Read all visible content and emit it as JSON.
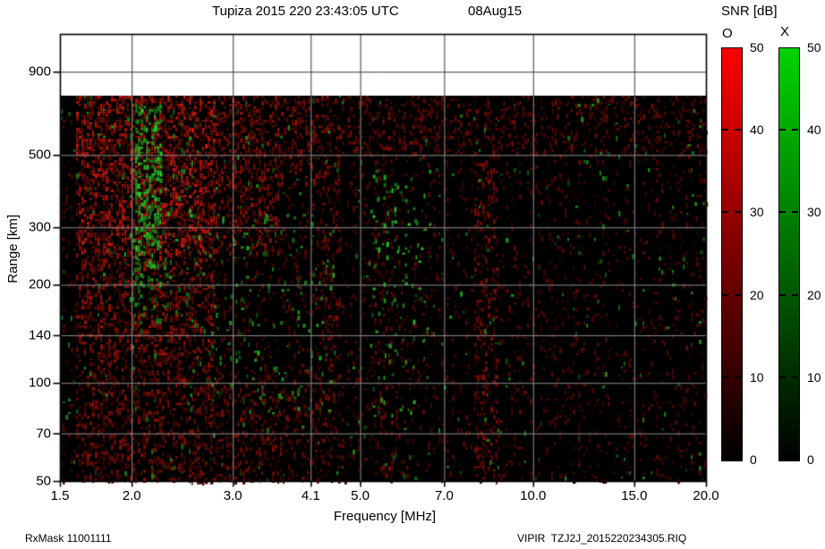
{
  "title": {
    "station_datetime": "Tupiza 2015 220 23:43:05 UTC",
    "date_short": "08Aug15"
  },
  "colorbar": {
    "title": "SNR [dB]",
    "o_label": "O",
    "x_label": "X",
    "ticks": [
      50,
      40,
      30,
      20,
      10,
      0
    ],
    "o_top_color": "#ff0000",
    "x_top_color": "#00d400",
    "bottom_color": "#000000"
  },
  "axes": {
    "x_label": "Frequency [MHz]",
    "y_label": "Range [km]"
  },
  "footer": {
    "rx_mask": "RxMask 11001111",
    "file": "VIPIR  TZJ2J_2015220234305.RIQ"
  },
  "chart_data": {
    "type": "heatmap",
    "title": "Tupiza 2015 220 23:43:05 UTC 08Aug15",
    "xlabel": "Frequency [MHz]",
    "ylabel": "Range [km]",
    "legend": [
      "O",
      "X"
    ],
    "colorbar_label": "SNR [dB]",
    "snr_range_db": [
      0,
      50
    ],
    "x_scale": "log",
    "y_scale": "log",
    "xlim": [
      1.5,
      20
    ],
    "ylim": [
      50,
      1175
    ],
    "x_ticks": [
      1.5,
      2.0,
      3.0,
      4.1,
      5.0,
      7.0,
      10.0,
      15.0,
      20.0
    ],
    "y_ticks": [
      50,
      70,
      100,
      140,
      200,
      300,
      500,
      900
    ],
    "grid": true,
    "data_top_km": 760,
    "background": "#000000",
    "noise_regions": [
      {
        "f": [
          1.5,
          20
        ],
        "r": [
          50,
          760
        ],
        "color": "red",
        "density": 0.1,
        "bright": [
          0.1,
          0.35
        ]
      },
      {
        "f": [
          1.6,
          2.8
        ],
        "r": [
          250,
          760
        ],
        "color": "red",
        "density": 0.45,
        "bright": [
          0.18,
          0.8
        ]
      },
      {
        "f": [
          1.6,
          2.8
        ],
        "r": [
          120,
          250
        ],
        "color": "red",
        "density": 0.3,
        "bright": [
          0.15,
          0.65
        ]
      },
      {
        "f": [
          1.6,
          2.8
        ],
        "r": [
          50,
          120
        ],
        "color": "red",
        "density": 0.25,
        "bright": [
          0.15,
          0.55
        ]
      },
      {
        "f": [
          2.8,
          3.6
        ],
        "r": [
          250,
          760
        ],
        "color": "red",
        "density": 0.3,
        "bright": [
          0.15,
          0.6
        ]
      },
      {
        "f": [
          3.6,
          4.6
        ],
        "r": [
          400,
          760
        ],
        "color": "red",
        "density": 0.27,
        "bright": [
          0.15,
          0.55
        ]
      },
      {
        "f": [
          4.6,
          7.0
        ],
        "r": [
          500,
          760
        ],
        "color": "red",
        "density": 0.2,
        "bright": [
          0.12,
          0.5
        ]
      },
      {
        "f": [
          7.0,
          10.0
        ],
        "r": [
          500,
          760
        ],
        "color": "red",
        "density": 0.17,
        "bright": [
          0.12,
          0.45
        ]
      },
      {
        "f": [
          10.0,
          20.0
        ],
        "r": [
          500,
          760
        ],
        "color": "red",
        "density": 0.15,
        "bright": [
          0.1,
          0.45
        ]
      },
      {
        "f": [
          4.2,
          4.6
        ],
        "r": [
          50,
          400
        ],
        "color": "red",
        "density": 0.17,
        "bright": [
          0.1,
          0.5
        ]
      },
      {
        "f": [
          2.8,
          4.2
        ],
        "r": [
          50,
          110
        ],
        "color": "red",
        "density": 0.17,
        "bright": [
          0.1,
          0.5
        ]
      },
      {
        "f": [
          7.9,
          8.7
        ],
        "r": [
          50,
          500
        ],
        "color": "red",
        "density": 0.22,
        "bright": [
          0.12,
          0.55
        ]
      },
      {
        "f": [
          5.3,
          5.7
        ],
        "r": [
          50,
          500
        ],
        "color": "red",
        "density": 0.13,
        "bright": [
          0.1,
          0.45
        ]
      },
      {
        "f": [
          2.03,
          2.26
        ],
        "r": [
          230,
          720
        ],
        "color": "green",
        "density": 0.33,
        "bright": [
          0.45,
          1.0
        ]
      },
      {
        "f": [
          2.0,
          2.35
        ],
        "r": [
          150,
          230
        ],
        "color": "green",
        "density": 0.1,
        "bright": [
          0.35,
          0.85
        ]
      },
      {
        "f": [
          1.9,
          2.6
        ],
        "r": [
          150,
          700
        ],
        "color": "green",
        "density": 0.035,
        "bright": [
          0.3,
          0.8
        ]
      },
      {
        "f": [
          5.2,
          6.6
        ],
        "r": [
          80,
          460
        ],
        "color": "green",
        "density": 0.05,
        "bright": [
          0.3,
          0.9
        ]
      },
      {
        "f": [
          2.5,
          4.5
        ],
        "r": [
          80,
          330
        ],
        "color": "green",
        "density": 0.035,
        "bright": [
          0.3,
          0.8
        ]
      },
      {
        "f": [
          18.5,
          20
        ],
        "r": [
          250,
          750
        ],
        "color": "green",
        "density": 0.04,
        "bright": [
          0.3,
          0.8
        ]
      },
      {
        "f": [
          1.5,
          20
        ],
        "r": [
          50,
          760
        ],
        "color": "green",
        "density": 0.012,
        "bright": [
          0.25,
          0.7
        ]
      }
    ]
  }
}
